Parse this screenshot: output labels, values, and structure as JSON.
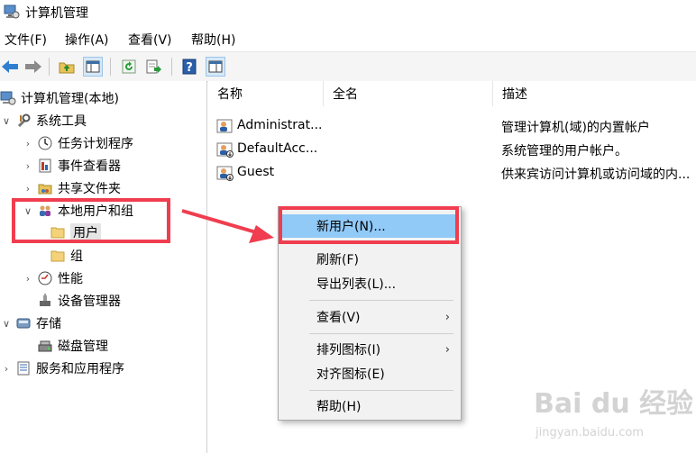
{
  "window": {
    "title": "计算机管理",
    "icon": "computer-management-icon"
  },
  "menubar": {
    "items": [
      "文件(F)",
      "操作(A)",
      "查看(V)",
      "帮助(H)"
    ]
  },
  "toolbar": {
    "buttons": [
      "back-arrow-icon",
      "forward-arrow-icon",
      "up-folder-icon",
      "show-hide-tree-icon",
      "refresh-icon",
      "export-list-icon",
      "help-icon",
      "properties-icon"
    ]
  },
  "tree": {
    "root": "计算机管理(本地)",
    "system_tools": "系统工具",
    "task_scheduler": "任务计划程序",
    "event_viewer": "事件查看器",
    "shared_folders": "共享文件夹",
    "local_users_groups": "本地用户和组",
    "users": "用户",
    "groups": "组",
    "performance": "性能",
    "device_manager": "设备管理器",
    "storage": "存储",
    "disk_management": "磁盘管理",
    "services_apps": "服务和应用程序"
  },
  "list": {
    "columns": [
      "名称",
      "全名",
      "描述"
    ],
    "rows": [
      {
        "name": "Administrat...",
        "full_name": "",
        "description": "管理计算机(域)的内置帐户"
      },
      {
        "name": "DefaultAcc...",
        "full_name": "",
        "description": "系统管理的用户帐户。"
      },
      {
        "name": "Guest",
        "full_name": "",
        "description": "供来宾访问计算机或访问域的内..."
      }
    ]
  },
  "context_menu": {
    "new_user": "新用户(N)...",
    "refresh": "刷新(F)",
    "export_list": "导出列表(L)...",
    "view": "查看(V)",
    "arrange_icons": "排列图标(I)",
    "line_up_icons": "对齐图标(E)",
    "help": "帮助(H)"
  },
  "watermark": {
    "brand": "Bai du 经验",
    "url": "jingyan.baidu.com"
  },
  "colors": {
    "annotation_red": "#f03d4f",
    "highlight_blue": "#91c9f7",
    "menu_bg": "#f2f2f2"
  }
}
